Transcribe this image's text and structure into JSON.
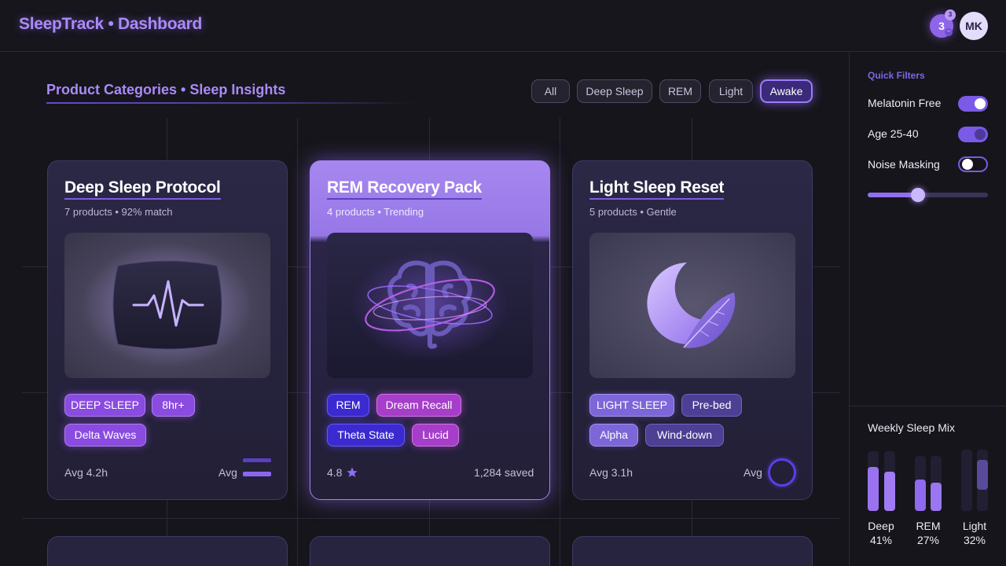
{
  "app": {
    "title": "SleepTrack • Dashboard"
  },
  "header": {
    "notification_count": "3",
    "notification_badge": "3",
    "notification_small": "~",
    "avatar_initials": "MK"
  },
  "section": {
    "title": "Product Categories • Sleep Insights",
    "filters": [
      {
        "label": "All",
        "active": false
      },
      {
        "label": "Deep Sleep",
        "active": false
      },
      {
        "label": "REM",
        "active": false
      },
      {
        "label": "Light",
        "active": false
      },
      {
        "label": "Awake",
        "active": true
      }
    ]
  },
  "cards": [
    {
      "title": "Deep Sleep Protocol",
      "subtitle": "7 products • 92% match",
      "image": "pillow-heartbeat-icon",
      "tags": [
        "DEEP SLEEP",
        "8hr+",
        "Delta Waves"
      ],
      "footer_left": "Avg 4.2h",
      "footer_right": "Avg"
    },
    {
      "title": "REM Recovery Pack",
      "subtitle": "4 products • Trending",
      "image": "brain-orbit-icon",
      "tags": [
        "REM",
        "Dream Recall",
        "Theta State",
        "Lucid"
      ],
      "footer_left": "4.8",
      "footer_right": "1,284 saved"
    },
    {
      "title": "Light Sleep Reset",
      "subtitle": "5 products • Gentle",
      "image": "moon-feather-icon",
      "tags": [
        "LIGHT SLEEP",
        "Pre-bed",
        "Alpha",
        "Wind-down"
      ],
      "footer_left": "Avg 3.1h",
      "footer_right": "Avg"
    }
  ],
  "sidebar": {
    "quick_filters_title": "Quick Filters",
    "filters": [
      {
        "label": "Melatonin Free",
        "state": "on"
      },
      {
        "label": "Age 25-40",
        "state": "on"
      },
      {
        "label": "Noise Masking",
        "state": "off"
      }
    ],
    "slider_value": 0.42,
    "weekly_mix": {
      "title": "Weekly Sleep Mix",
      "items": [
        {
          "name": "Deep",
          "percent": "41%",
          "value": 41
        },
        {
          "name": "REM",
          "percent": "27%",
          "value": 27
        },
        {
          "name": "Light",
          "percent": "32%",
          "value": 32
        }
      ]
    }
  },
  "colors": {
    "accent": "#a98bf7",
    "background": "#16151b",
    "card": "#252240",
    "featured": "#a787ef"
  }
}
